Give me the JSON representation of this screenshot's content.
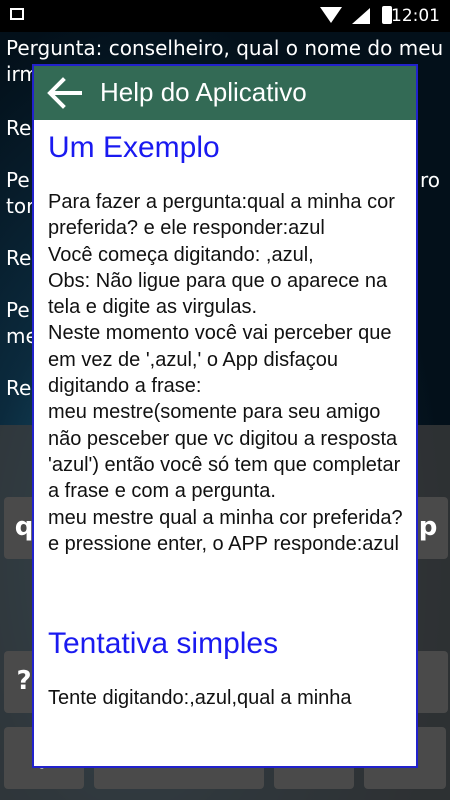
{
  "status_bar": {
    "time": "12:01"
  },
  "conversation": {
    "lines": [
      "Pergunta: conselheiro, qual o nome do meu",
      "irm",
      "Re",
      "Pe",
      "tor",
      "Re",
      "Pe",
      "me",
      "Re"
    ],
    "right_fragment": "ro"
  },
  "keyboard": {
    "keys": [
      "q",
      "p",
      "?",
      ","
    ]
  },
  "dialog": {
    "title": "Help do Aplicativo",
    "section1_title": "Um Exemplo",
    "section1_text": "    Para fazer a pergunta:qual a minha cor preferida?  e ele responder:azul\n    Você começa digitando: ,azul,\nObs: Não ligue para que o aparece na tela e digite as virgulas.\n     Neste momento você vai perceber que em vez de ',azul,' o App disfaçou digitando a frase:\n      meu mestre(somente para seu amigo não pesceber que vc digitou a resposta 'azul') então você só tem que completar a frase e com a pergunta.\nmeu mestre qual a minha cor preferida? e pressione enter, o APP responde:azul",
    "section2_title": "Tentativa simples",
    "section2_text": "    Tente digitando:,azul,qual a minha"
  }
}
